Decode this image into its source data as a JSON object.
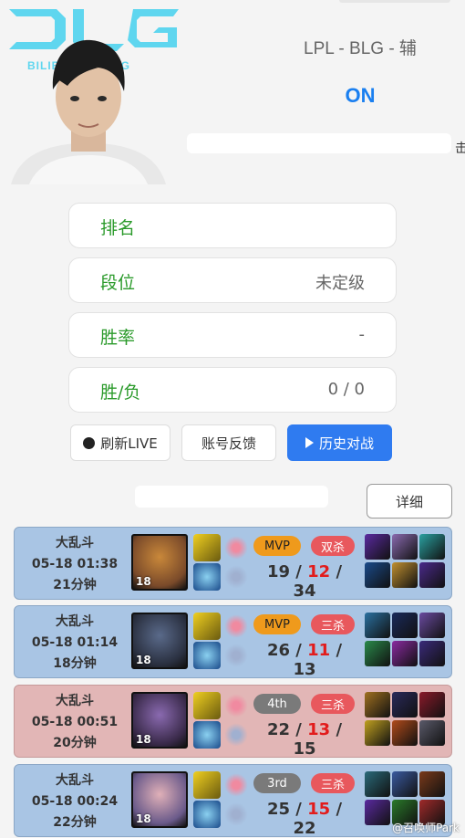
{
  "header": {
    "league": "LPL - BLG - 辅",
    "status": "ON",
    "edge_glyph": "击",
    "team_logo": {
      "text_big": "BLG",
      "text_small": "BILIBILI GAMING",
      "color": "#5fd6ef"
    }
  },
  "stats": [
    {
      "label": "排名",
      "value": ""
    },
    {
      "label": "段位",
      "value": "未定级"
    },
    {
      "label": "胜率",
      "value": "-"
    },
    {
      "label": "胜/负",
      "value": "0 / 0"
    }
  ],
  "buttons": {
    "refresh": "刷新LIVE",
    "feedback": "账号反馈",
    "history": "历史对战",
    "detail": "详细"
  },
  "matches": [
    {
      "mode": "大乱斗",
      "date": "05-18 01:38",
      "duration": "21分钟",
      "result": "win",
      "level": "18",
      "badge1": "MVP",
      "badge1_type": "mvp",
      "badge2": "双杀",
      "kills": "19",
      "deaths": "12",
      "assists": "34",
      "sep": "/"
    },
    {
      "mode": "大乱斗",
      "date": "05-18 01:14",
      "duration": "18分钟",
      "result": "win",
      "level": "18",
      "badge1": "MVP",
      "badge1_type": "mvp",
      "badge2": "三杀",
      "kills": "26",
      "deaths": "11",
      "assists": "13",
      "sep": "/"
    },
    {
      "mode": "大乱斗",
      "date": "05-18 00:51",
      "duration": "20分钟",
      "result": "loss",
      "level": "18",
      "badge1": "4th",
      "badge1_type": "rank",
      "badge2": "三杀",
      "kills": "22",
      "deaths": "13",
      "assists": "15",
      "sep": "/"
    },
    {
      "mode": "大乱斗",
      "date": "05-18 00:24",
      "duration": "22分钟",
      "result": "win",
      "level": "18",
      "badge1": "3rd",
      "badge1_type": "rank",
      "badge2": "三杀",
      "kills": "25",
      "deaths": "15",
      "assists": "22",
      "sep": "/"
    }
  ],
  "watermark": "@召唤师Park",
  "colors": {
    "accent": "#2f7bf0",
    "win_bg": "#a9c5e4",
    "loss_bg": "#e2b6b6",
    "label_green": "#2a9a2a",
    "death_red": "#e21c1c"
  }
}
